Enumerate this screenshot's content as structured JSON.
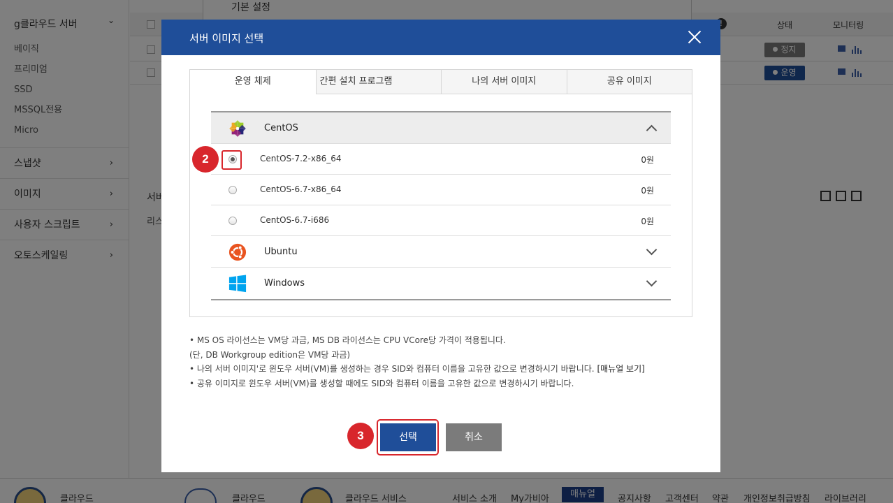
{
  "sidebar": {
    "group_title": "g클라우드 서버",
    "sub_items": [
      "베이직",
      "프리미엄",
      "SSD",
      "MSSQL전용",
      "Micro"
    ],
    "items": [
      "스냅샷",
      "이미지",
      "사용자 스크립트",
      "오토스케일링"
    ]
  },
  "background": {
    "behind_title": "기본 설정",
    "col_state": "상태",
    "col_monitoring": "모니터링",
    "rows": [
      {
        "status": "정지",
        "status_color": "#7b7b7b"
      },
      {
        "status": "운영",
        "status_color": "#1f4e99"
      }
    ],
    "section_title": "서버",
    "section_list": "리스"
  },
  "footer": {
    "links": [
      "서비스 소개",
      "My가비아",
      "매뉴얼",
      "공지사항",
      "고객센터",
      "약관",
      "개인정보취급방침",
      "라이브러리"
    ],
    "left_labels": [
      "클라우드",
      "클라우드",
      "클라우드 서비스"
    ]
  },
  "modal": {
    "title": "서버 이미지 선택",
    "tabs": [
      "운영 체제",
      "간편 설치 프로그램",
      "나의 서버 이미지",
      "공유 이미지"
    ],
    "os_groups": [
      {
        "name": "CentOS",
        "icon": "centos-logo-icon",
        "expanded": true,
        "images": [
          {
            "name": "CentOS-7.2-x86_64",
            "price": "0원",
            "selected": true
          },
          {
            "name": "CentOS-6.7-x86_64",
            "price": "0원",
            "selected": false
          },
          {
            "name": "CentOS-6.7-i686",
            "price": "0원",
            "selected": false
          }
        ]
      },
      {
        "name": "Ubuntu",
        "icon": "ubuntu-logo-icon",
        "expanded": false
      },
      {
        "name": "Windows",
        "icon": "windows-logo-icon",
        "expanded": false
      }
    ],
    "notes": [
      "• MS OS 라이선스는 VM당 과금, MS DB 라이선스는 CPU VCore당 가격이 적용됩니다.",
      "(단, DB Workgroup edition은 VM당 과금)",
      "• 나의 서버 이미지'로 윈도우 서버(VM)를 생성하는 경우 SID와 컴퓨터 이름을 고유한 값으로 변경하시기 바랍니다.",
      "[매뉴얼 보기]",
      "• 공유 이미지로 윈도우 서버(VM)를 생성할 때에도 SID와 컴퓨터 이름을 고유한 값으로 변경하시기 바랍니다."
    ],
    "select_label": "선택",
    "cancel_label": "취소"
  },
  "annotations": {
    "step_radio": "2",
    "step_button": "3",
    "marker_color": "#d8262c"
  },
  "colors": {
    "primary": "#1f4e99",
    "cancel": "#7b7b7b"
  }
}
